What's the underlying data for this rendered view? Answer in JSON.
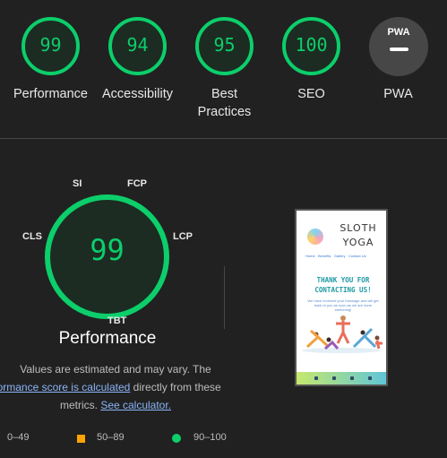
{
  "categories": [
    {
      "label": "Performance",
      "score": "99"
    },
    {
      "label": "Accessibility",
      "score": "94"
    },
    {
      "label": "Best Practices",
      "line1": "Best",
      "line2": "Practices",
      "score": "95"
    },
    {
      "label": "SEO",
      "score": "100"
    },
    {
      "label": "PWA",
      "logo": "PWA",
      "icon": "pwa-icon"
    }
  ],
  "performance": {
    "score": "99",
    "title": "Performance",
    "metrics": [
      "SI",
      "FCP",
      "LCP",
      "TBT",
      "CLS"
    ]
  },
  "note": {
    "line1": "Values are estimated and may vary. The",
    "link1": "rformance score is calculated",
    "line2_rest": " directly from these",
    "line3_start": "metrics. ",
    "link2": "See calculator."
  },
  "legend": {
    "fail": "0–49",
    "average": "50–89",
    "pass": "90–100"
  },
  "screenshot": {
    "title_line1": "SLOTH",
    "title_line2": "YOGA",
    "nav": [
      "Home",
      "Benefits",
      "Gallery",
      "Contact Us"
    ],
    "heading_line1": "THANK YOU FOR",
    "heading_line2": "CONTACTING US!",
    "body": "We have received your message and will get back to you as soon as we are done stretching!"
  },
  "colors": {
    "pass": "#0cce6b",
    "average": "#ffa400",
    "background": "#212121",
    "link": "#8ab4f8"
  }
}
